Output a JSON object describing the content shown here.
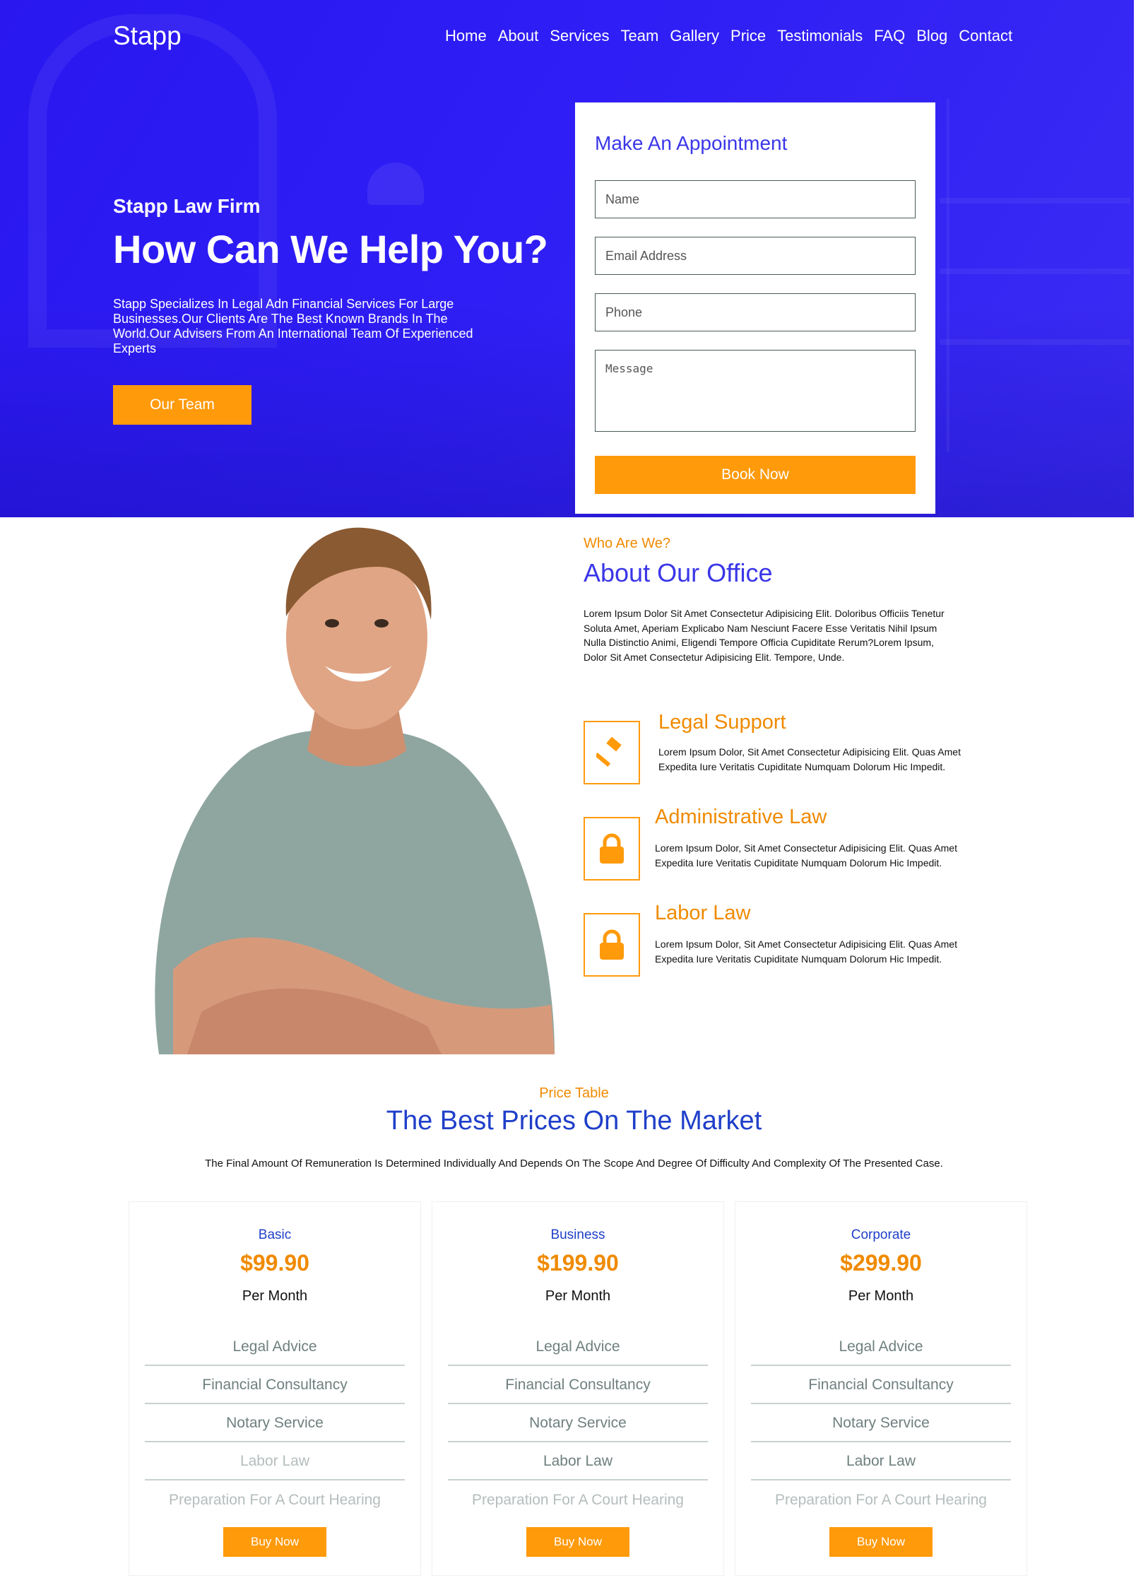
{
  "brand": "Stapp",
  "nav": [
    "Home",
    "About",
    "Services",
    "Team",
    "Gallery",
    "Price",
    "Testimonials",
    "FAQ",
    "Blog",
    "Contact"
  ],
  "hero": {
    "eyebrow": "Stapp Law Firm",
    "title": "How Can We Help You?",
    "text": "Stapp Specializes In Legal Adn Financial Services For Large Businesses.Our Clients Are The Best Known Brands In The World.Our Advisers From An International Team Of Experienced Experts",
    "button": "Our Team"
  },
  "appointment": {
    "title": "Make An Appointment",
    "name_placeholder": "Name",
    "email_placeholder": "Email Address",
    "phone_placeholder": "Phone",
    "message_placeholder": "Message",
    "button": "Book Now"
  },
  "about": {
    "eyebrow": "Who Are We?",
    "title": "About Our Office",
    "text": "Lorem Ipsum Dolor Sit Amet Consectetur Adipisicing Elit. Doloribus Officiis Tenetur Soluta Amet, Aperiam Explicabo Nam Nesciunt Facere Esse Veritatis Nihil Ipsum Nulla Distinctio Animi, Eligendi Tempore Officia Cupiditate Rerum?Lorem Ipsum, Dolor Sit Amet Consectetur Adipisicing Elit. Tempore, Unde.",
    "services": [
      {
        "icon": "gavel-icon",
        "title": "Legal Support",
        "text": "Lorem Ipsum Dolor, Sit Amet Consectetur Adipisicing Elit. Quas Amet Expedita Iure Veritatis Cupiditate Numquam Dolorum Hic Impedit."
      },
      {
        "icon": "lock-icon",
        "title": "Administrative Law",
        "text": "Lorem Ipsum Dolor, Sit Amet Consectetur Adipisicing Elit. Quas Amet Expedita Iure Veritatis Cupiditate Numquam Dolorum Hic Impedit."
      },
      {
        "icon": "lock-icon",
        "title": "Labor Law",
        "text": "Lorem Ipsum Dolor, Sit Amet Consectetur Adipisicing Elit. Quas Amet Expedita Iure Veritatis Cupiditate Numquam Dolorum Hic Impedit."
      }
    ]
  },
  "pricing": {
    "eyebrow": "Price Table",
    "title": "The Best Prices On The Market",
    "subtitle": "The Final Amount Of Remuneration Is Determined Individually And Depends On The Scope And Degree Of Difficulty And Complexity Of The Presented Case.",
    "plans": [
      {
        "name": "Basic",
        "price": "$99.90",
        "period": "Per Month",
        "features": [
          "Legal Advice",
          "Financial Consultancy",
          "Notary Service",
          "Labor Law",
          "Preparation For A Court Hearing"
        ],
        "button": "Buy Now"
      },
      {
        "name": "Business",
        "price": "$199.90",
        "period": "Per Month",
        "features": [
          "Legal Advice",
          "Financial Consultancy",
          "Notary Service",
          "Labor Law",
          "Preparation For A Court Hearing"
        ],
        "button": "Buy Now"
      },
      {
        "name": "Corporate",
        "price": "$299.90",
        "period": "Per Month",
        "features": [
          "Legal Advice",
          "Financial Consultancy",
          "Notary Service",
          "Labor Law",
          "Preparation For A Court Hearing"
        ],
        "button": "Buy Now"
      }
    ]
  },
  "colors": {
    "hero_blue": "#2f1ef5",
    "accent_orange": "#ff9a0b",
    "title_blue": "#1f3fc9"
  }
}
